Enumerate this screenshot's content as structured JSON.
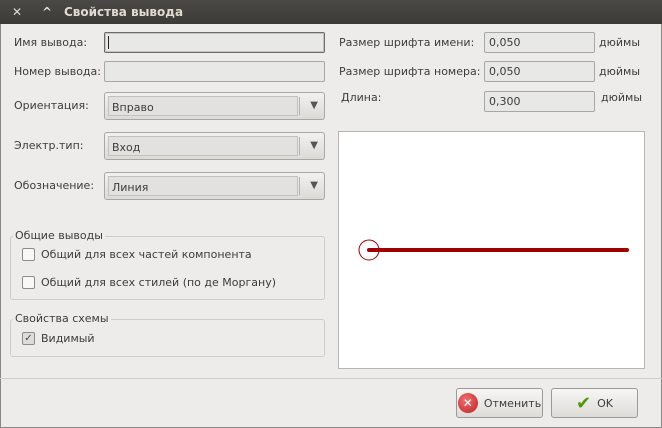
{
  "window": {
    "title": "Свойства вывода",
    "close_glyph": "✕",
    "shade_glyph": "^"
  },
  "fields": {
    "pin_name_label": "Имя вывода:",
    "pin_name_value": "",
    "pin_number_label": "Номер вывода:",
    "pin_number_value": "",
    "orientation_label": "Ориентация:",
    "orientation_value": "Вправо",
    "elec_type_label": "Электр.тип:",
    "elec_type_value": "Вход",
    "shape_label": "Обозначение:",
    "shape_value": "Линия"
  },
  "sizes": {
    "name_size_label": "Размер шрифта имени:",
    "name_size_value": "0,050",
    "number_size_label": "Размер шрифта номера:",
    "number_size_value": "0,050",
    "length_label": "Длина:",
    "length_value": "0,300",
    "unit": "дюймы"
  },
  "common": {
    "title": "Общие выводы",
    "all_parts_label": "Общий для всех частей компонента",
    "all_parts_checked": false,
    "all_styles_label": "Общий для всех стилей (по де Моргану)",
    "all_styles_checked": false
  },
  "schematic": {
    "title": "Свойства схемы",
    "visible_label": "Видимый",
    "visible_checked": true
  },
  "buttons": {
    "cancel_label": "Отменить",
    "ok_label": "OK"
  },
  "colors": {
    "pin_line": "#a00000",
    "accent_ok": "#4e9a06",
    "accent_cancel": "#c02020"
  },
  "glyphs": {
    "dropdown_arrow": "▼",
    "check_mark": "✓",
    "cancel_icon": "✕",
    "ok_icon": "✔"
  }
}
